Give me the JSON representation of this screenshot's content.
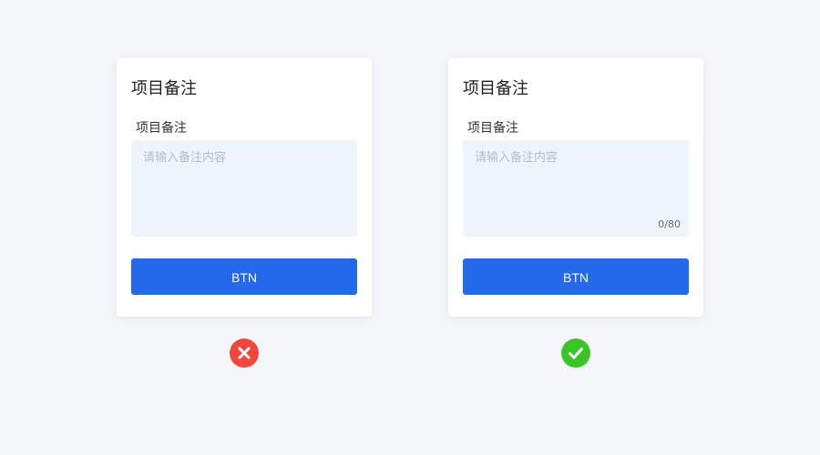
{
  "cards": {
    "bad": {
      "title": "项目备注",
      "field_label": "项目备注",
      "placeholder": "请输入备注内容",
      "button_label": "BTN"
    },
    "good": {
      "title": "项目备注",
      "field_label": "项目备注",
      "placeholder": "请输入备注内容",
      "counter": "0/80",
      "button_label": "BTN"
    }
  },
  "status_icons": {
    "bad": "close-icon",
    "good": "check-icon"
  },
  "colors": {
    "background": "#f5f6fa",
    "primary": "#2468ec",
    "textarea_bg": "#eff3fa",
    "error": "#f2473c",
    "success": "#3ac426"
  }
}
